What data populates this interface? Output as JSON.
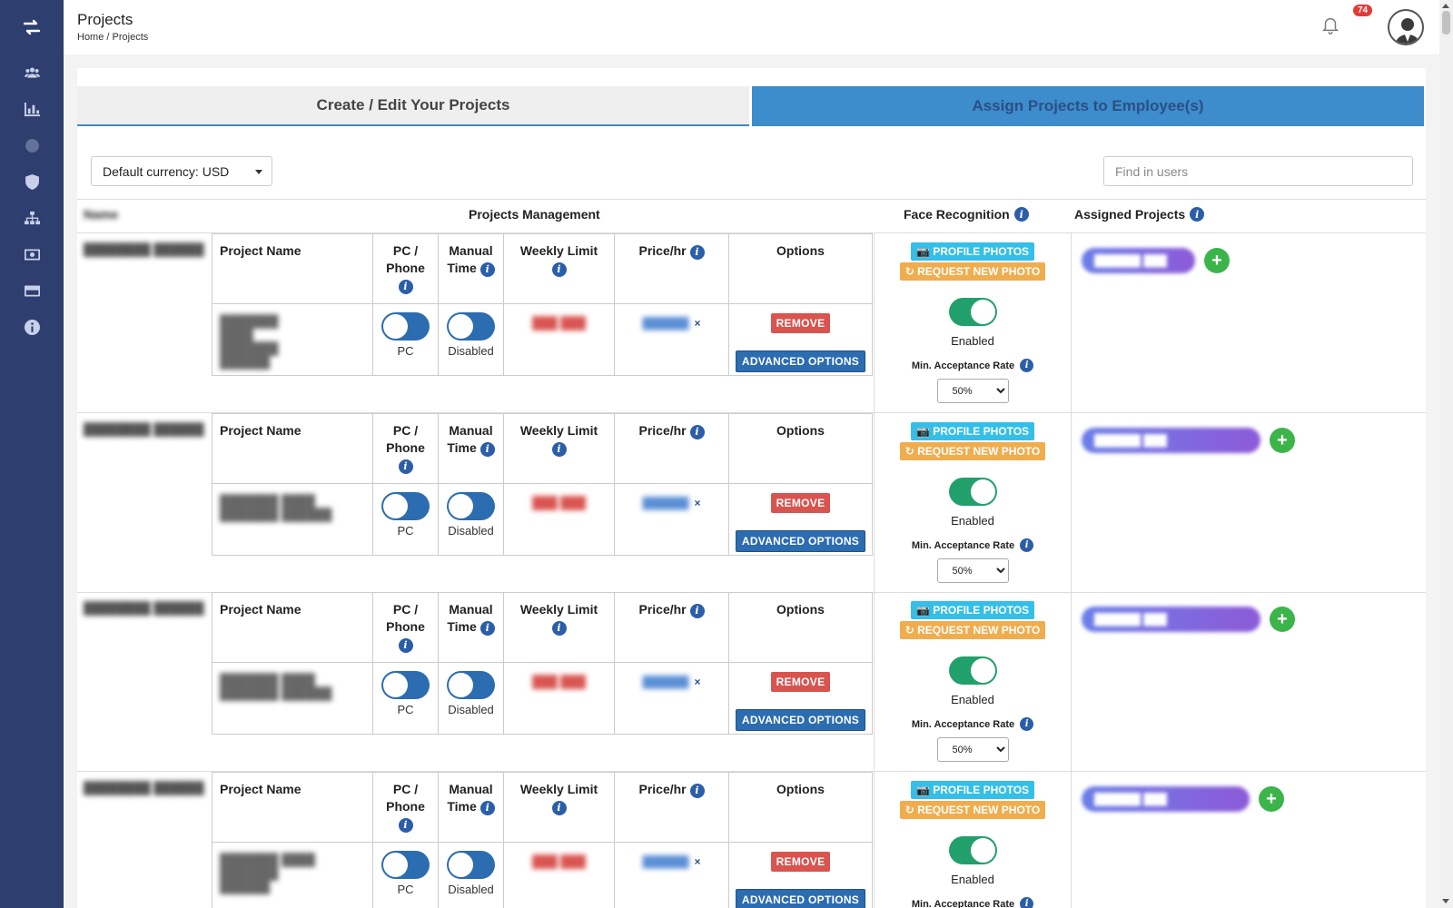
{
  "header": {
    "title": "Projects",
    "breadcrumb": "Home / Projects",
    "notification_count": "74"
  },
  "sidebar": {
    "logo_icon": "arrows-swap-icon",
    "items": [
      {
        "icon": "users-icon"
      },
      {
        "icon": "bar-chart-icon"
      },
      {
        "icon": "settings-icon"
      },
      {
        "icon": "shield-icon"
      },
      {
        "icon": "sitemap-icon"
      },
      {
        "icon": "money-icon"
      },
      {
        "icon": "credit-card-icon"
      },
      {
        "icon": "info-icon"
      }
    ]
  },
  "tabs": {
    "create": "Create / Edit Your Projects",
    "assign": "Assign Projects to Employee(s)"
  },
  "toolbar": {
    "currency": "Default currency: USD",
    "search_placeholder": "Find in users"
  },
  "columns": {
    "name": "Name",
    "projects_management": "Projects Management",
    "face_recognition": "Face Recognition",
    "assigned_projects": "Assigned Projects"
  },
  "subcolumns": {
    "project_name": "Project Name",
    "pc_phone_1": "PC /",
    "pc_phone_2": "Phone",
    "manual_1": "Manual",
    "manual_2": "Time",
    "weekly_1": "Weekly Limit",
    "price": "Price/hr",
    "options": "Options"
  },
  "labels": {
    "pc": "PC",
    "disabled": "Disabled",
    "remove": "REMOVE",
    "advanced": "ADVANCED OPTIONS",
    "profile_photos": "PROFILE PHOTOS",
    "request_photo": "REQUEST NEW PHOTO",
    "enabled": "Enabled",
    "min_rate": "Min. Acceptance Rate",
    "rate_value": "50%",
    "xmark": "×",
    "plus": "+",
    "info": "i"
  },
  "colors": {
    "sidebar": "#2e3e6e",
    "tab_active": "#3d8ccb",
    "toggle_on": "#22a06b",
    "toggle_off": "#2c6cb0",
    "remove": "#d9534f",
    "photos": "#33bfe8",
    "request": "#f0ad4e",
    "plus": "#3bb54a"
  }
}
